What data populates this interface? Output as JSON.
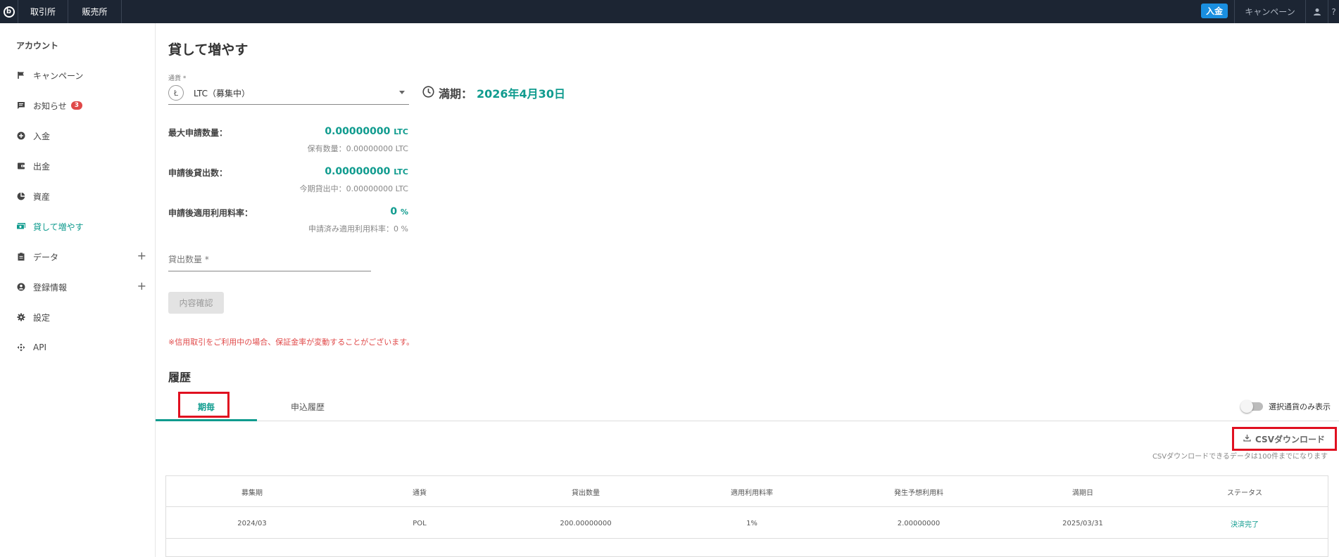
{
  "topbar": {
    "nav": [
      "取引所",
      "販売所"
    ],
    "deposit_label": "入金",
    "campaign_label": "キャンペーン",
    "help_label": "?"
  },
  "sidebar": {
    "account_label": "アカウント",
    "items": [
      {
        "label": "キャンペーン",
        "icon": "flag-icon"
      },
      {
        "label": "お知らせ",
        "icon": "message-icon",
        "badge": "3"
      },
      {
        "label": "入金",
        "icon": "plus-circle-icon"
      },
      {
        "label": "出金",
        "icon": "wallet-icon"
      },
      {
        "label": "資産",
        "icon": "pie-chart-icon"
      },
      {
        "label": "貸して増やす",
        "icon": "lend-icon",
        "active": true
      },
      {
        "label": "データ",
        "icon": "clipboard-icon",
        "expandable": true
      },
      {
        "label": "登録情報",
        "icon": "account-icon",
        "expandable": true
      },
      {
        "label": "設定",
        "icon": "gear-icon"
      },
      {
        "label": "API",
        "icon": "api-icon"
      }
    ]
  },
  "main": {
    "title": "貸して増やす",
    "currency": {
      "label": "通貨 *",
      "value": "LTC（募集中）"
    },
    "maturity": {
      "label": "満期：",
      "value": "2026年4月30日"
    },
    "info": [
      {
        "label": "最大申請数量：",
        "value": "0.00000000",
        "unit": "LTC",
        "sub": "保有数量：0.00000000 LTC"
      },
      {
        "label": "申請後貸出数：",
        "value": "0.00000000",
        "unit": "LTC",
        "sub": "今期貸出中：0.00000000 LTC"
      },
      {
        "label": "申請後適用利用料率：",
        "value": "0",
        "unit": "%",
        "sub": "申請済み適用利用料率：0 %"
      }
    ],
    "amount_placeholder": "貸出数量 *",
    "confirm_label": "内容確認",
    "warning": "※信用取引をご利用中の場合、保証金率が変動することがございます。"
  },
  "history": {
    "title": "履歴",
    "tabs": [
      "期毎",
      "申込履歴"
    ],
    "active_tab": 0,
    "toggle_label": "選択通貨のみ表示",
    "csv_label": "CSVダウンロード",
    "csv_note": "CSVダウンロードできるデータは100件までになります",
    "columns": [
      "募集期",
      "通貨",
      "貸出数量",
      "適用利用料率",
      "発生予想利用料",
      "満期日",
      "ステータス"
    ],
    "rows": [
      [
        "2024/03",
        "POL",
        "200.00000000",
        "1%",
        "2.00000000",
        "2025/03/31",
        "決済完了"
      ]
    ]
  },
  "colors": {
    "accent": "#0f9b8e",
    "topbar": "#1c2533",
    "deposit": "#1a8fe0",
    "warning": "#e04848",
    "highlight": "#e01020"
  }
}
